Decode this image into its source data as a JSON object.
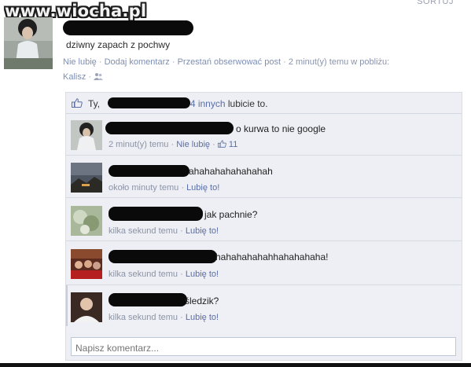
{
  "watermark": "www.wiocha.pl",
  "top_right": "SORTUJ",
  "post": {
    "text": "dziwny zapach z pochwy",
    "actions": {
      "unlike": "Nie lubię",
      "comment": "Dodaj komentarz",
      "unfollow": "Przestań obserwować post",
      "time": "2 minut(y) temu w pobliżu:",
      "location": "Kalisz"
    }
  },
  "likes": {
    "prefix": "Ty,",
    "others": "i 4 innych",
    "suffix": "lubicie to."
  },
  "comments": [
    {
      "text": "o kurwa to nie google",
      "time": "2 minut(y) temu",
      "action": "Nie lubię",
      "like_count": "11"
    },
    {
      "text": "ahahahahahahahah",
      "time": "około minuty temu",
      "action": "Lubię to!"
    },
    {
      "text": "jak pachnie?",
      "time": "kilka sekund temu",
      "action": "Lubię to!"
    },
    {
      "text": "hahahahahahhahahahaha!",
      "time": "kilka sekund temu",
      "action": "Lubię to!"
    },
    {
      "text": "śledzik?",
      "time": "kilka sekund temu",
      "action": "Lubię to!"
    }
  ],
  "comment_input": {
    "placeholder": "Napisz komentarz..."
  },
  "colors": {
    "link": "#5a6ea8",
    "panel": "#edeff4",
    "meta": "#8b93a7"
  },
  "icons": [
    "thumbs-up-icon",
    "people-icon"
  ]
}
